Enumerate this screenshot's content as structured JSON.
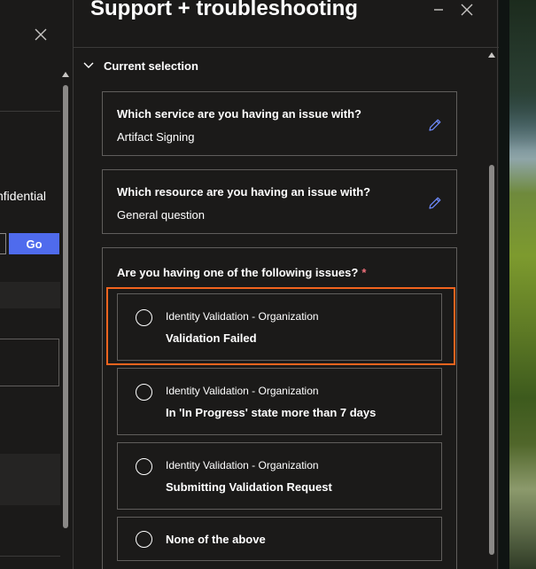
{
  "left_panel": {
    "partial_text": "nfidential",
    "go_label": "Go"
  },
  "blade": {
    "title": "Support + troubleshooting",
    "section_label": "Current selection",
    "selections": [
      {
        "question": "Which service are you having an issue with?",
        "answer": "Artifact Signing"
      },
      {
        "question": "Which resource are you having an issue with?",
        "answer": "General question"
      }
    ],
    "issues": {
      "question": "Are you having one of the following issues?",
      "required_marker": "*",
      "options": [
        {
          "category": "Identity Validation - Organization",
          "title": "Validation Failed",
          "highlighted": true
        },
        {
          "category": "Identity Validation - Organization",
          "title": "In 'In Progress' state more than 7 days"
        },
        {
          "category": "Identity Validation - Organization",
          "title": "Submitting Validation Request"
        },
        {
          "category": "",
          "title": "None of the above"
        }
      ]
    }
  },
  "icons": {
    "close": "close-icon",
    "minimize": "minimize-icon",
    "chevron": "chevron-down-icon",
    "edit": "pencil-icon",
    "radio": "radio-unchecked-icon"
  },
  "colors": {
    "background": "#1b1a19",
    "accent_button": "#4f6bed",
    "highlight_box": "#f2641e",
    "required": "#f1707b",
    "edit_icon": "#6f8cff"
  }
}
